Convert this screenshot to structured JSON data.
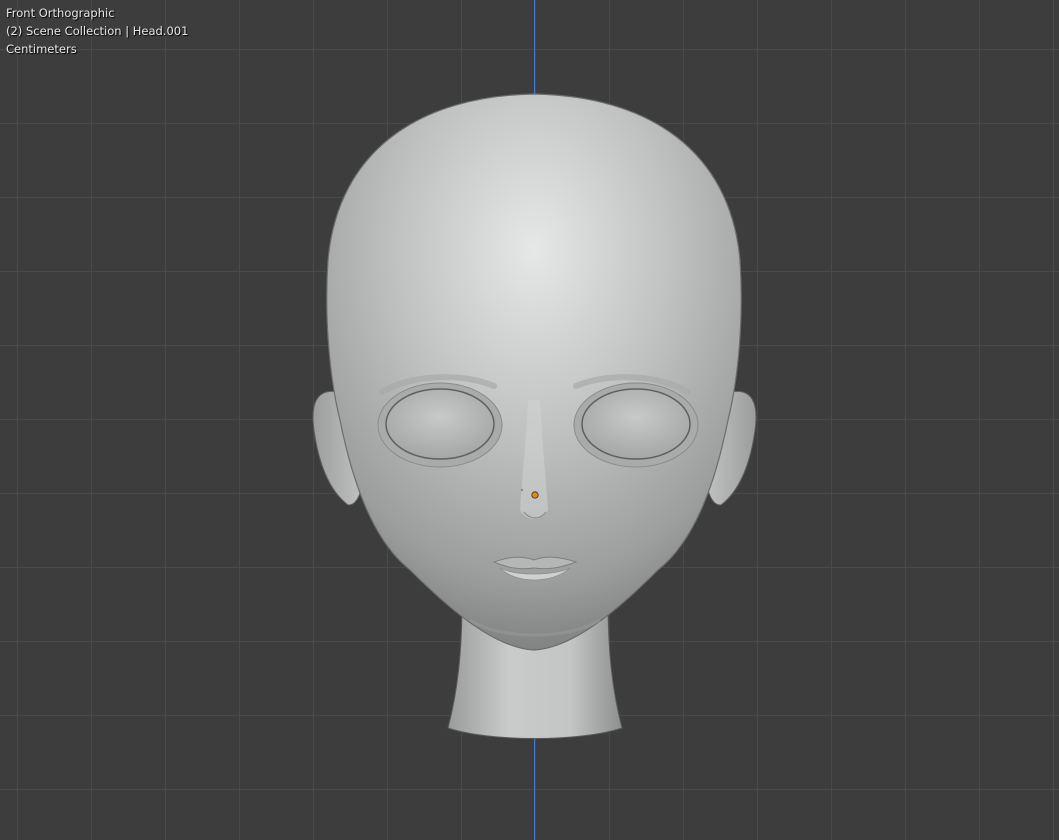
{
  "viewport": {
    "view_name": "Front Orthographic",
    "collection_info": "(2) Scene Collection | Head.001",
    "units": "Centimeters",
    "background_color": "#3d3d3d",
    "grid_color": "#4a4a4a",
    "axis_color": "#3f7ad1",
    "origin_color": "#e08a1e"
  },
  "model": {
    "object_name": "Head.001",
    "shading": "solid",
    "icon": "head-mesh-icon"
  }
}
